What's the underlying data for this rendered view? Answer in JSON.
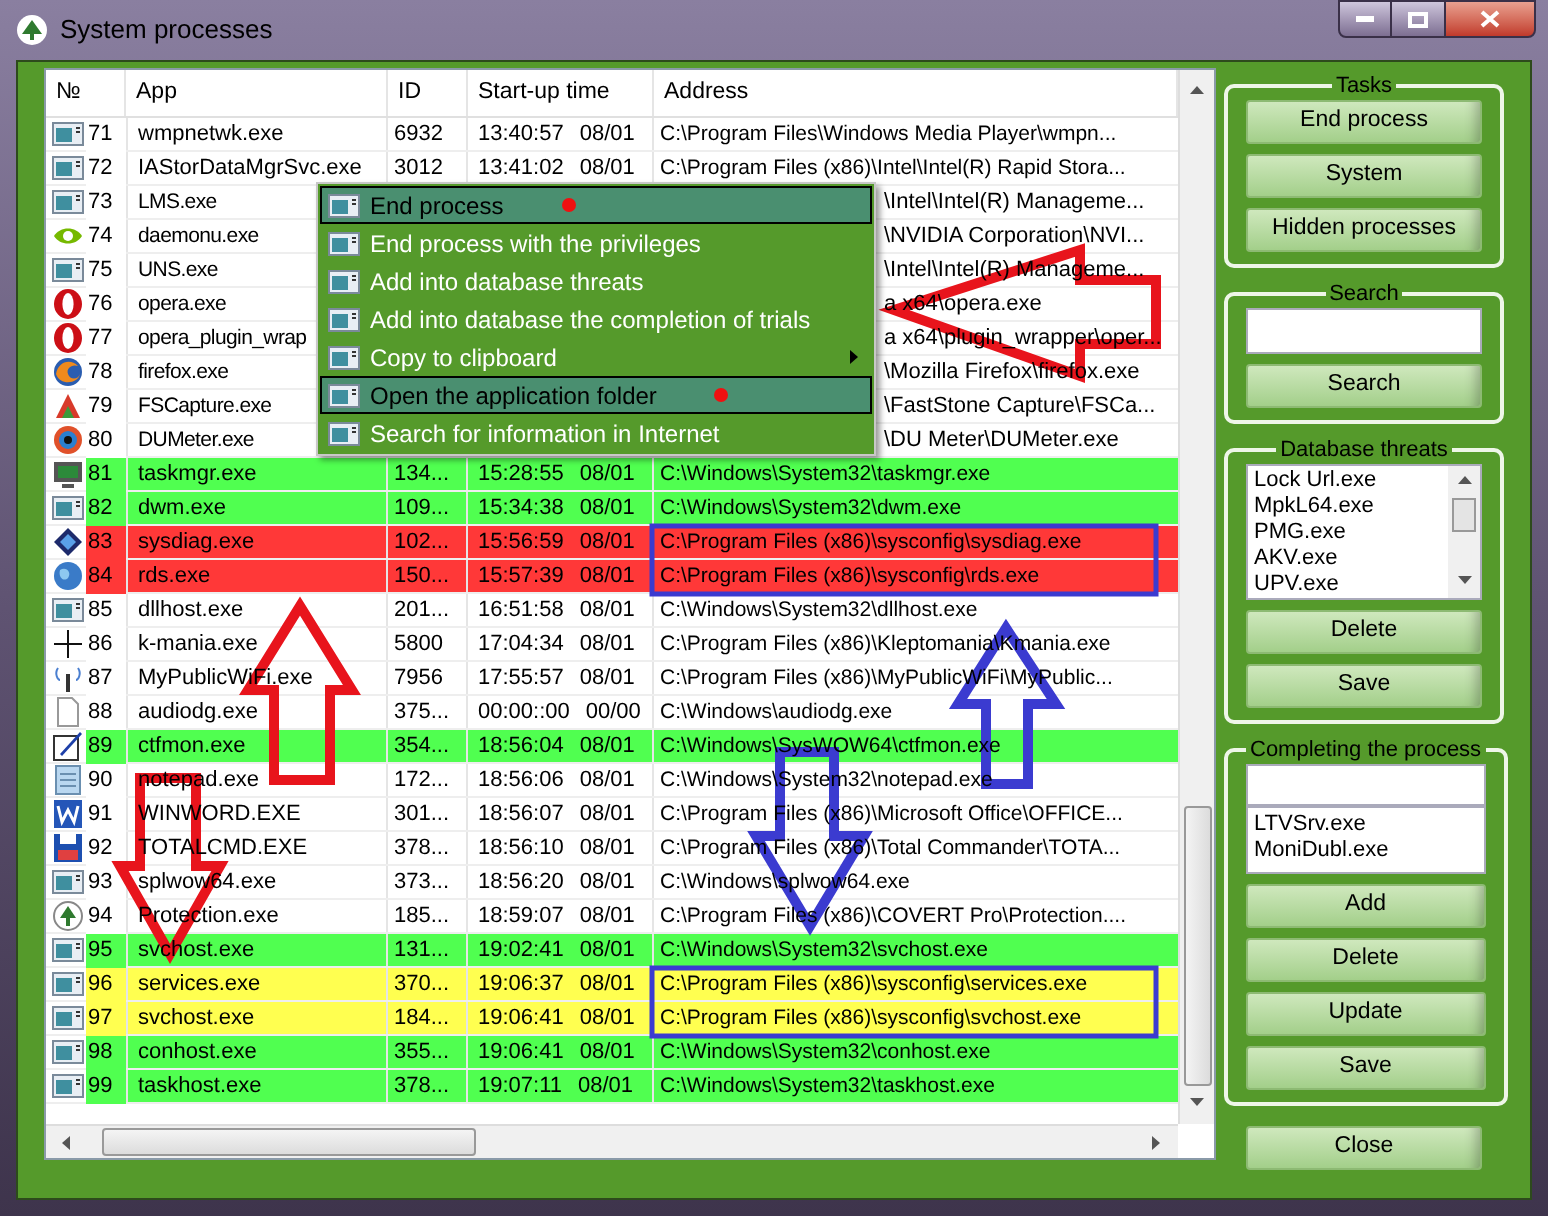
{
  "window": {
    "title": "System processes"
  },
  "table": {
    "columns": [
      "№",
      "App",
      "ID",
      "Start-up time",
      "Address"
    ],
    "rows": [
      {
        "no": "71",
        "app": "wmpnetwk.exe",
        "id": "6932",
        "time": "13:40:57",
        "date": "08/01",
        "address": "C:\\Program Files\\Windows Media Player\\wmpn...",
        "color": "#ffffff",
        "covered": false
      },
      {
        "no": "72",
        "app": "IAStorDataMgrSvc.exe",
        "id": "3012",
        "time": "13:41:02",
        "date": "08/01",
        "address": "C:\\Program Files (x86)\\Intel\\Intel(R) Rapid Stora...",
        "color": "#ffffff",
        "covered": false
      },
      {
        "no": "73",
        "app": "LMS.exe",
        "address": "\\Intel\\Intel(R) Manageme...",
        "color": "#ffffff",
        "covered": true
      },
      {
        "no": "74",
        "app": "daemonu.exe",
        "address": "\\NVIDIA Corporation\\NVI...",
        "color": "#ffffff",
        "covered": true
      },
      {
        "no": "75",
        "app": "UNS.exe",
        "address": "\\Intel\\Intel(R) Manageme...",
        "color": "#ffffff",
        "covered": true
      },
      {
        "no": "76",
        "app": "opera.exe",
        "address": "a x64\\opera.exe",
        "color": "#ffffff",
        "covered": true
      },
      {
        "no": "77",
        "app": "opera_plugin_wrap",
        "address": "a x64\\plugin_wrapper\\oper...",
        "color": "#ffffff",
        "covered": true
      },
      {
        "no": "78",
        "app": "firefox.exe",
        "address": "\\Mozilla Firefox\\firefox.exe",
        "color": "#ffffff",
        "covered": true
      },
      {
        "no": "79",
        "app": "FSCapture.exe",
        "address": "\\FastStone Capture\\FSCa...",
        "color": "#ffffff",
        "covered": true
      },
      {
        "no": "80",
        "app": "DUMeter.exe",
        "address": "\\DU Meter\\DUMeter.exe",
        "color": "#ffffff",
        "covered": true
      },
      {
        "no": "81",
        "app": "taskmgr.exe",
        "id": "134...",
        "time": "15:28:55",
        "date": "08/01",
        "address": "C:\\Windows\\System32\\taskmgr.exe",
        "color": "#50ff50",
        "covered": false
      },
      {
        "no": "82",
        "app": "dwm.exe",
        "id": "109...",
        "time": "15:34:38",
        "date": "08/01",
        "address": "C:\\Windows\\System32\\dwm.exe",
        "color": "#50ff50",
        "covered": false
      },
      {
        "no": "83",
        "app": "sysdiag.exe",
        "id": "102...",
        "time": "15:56:59",
        "date": "08/01",
        "address": "C:\\Program Files (x86)\\sysconfig\\sysdiag.exe",
        "color": "#ff3838",
        "covered": false
      },
      {
        "no": "84",
        "app": "rds.exe",
        "id": "150...",
        "time": "15:57:39",
        "date": "08/01",
        "address": "C:\\Program Files (x86)\\sysconfig\\rds.exe",
        "color": "#ff3838",
        "covered": false
      },
      {
        "no": "85",
        "app": "dllhost.exe",
        "id": "201...",
        "time": "16:51:58",
        "date": "08/01",
        "address": "C:\\Windows\\System32\\dllhost.exe",
        "color": "#ffffff",
        "covered": false
      },
      {
        "no": "86",
        "app": "k-mania.exe",
        "id": "5800",
        "time": "17:04:34",
        "date": "08/01",
        "address": "C:\\Program Files (x86)\\Kleptomania\\Kmania.exe",
        "color": "#ffffff",
        "covered": false
      },
      {
        "no": "87",
        "app": "MyPublicWiFi.exe",
        "id": "7956",
        "time": "17:55:57",
        "date": "08/01",
        "address": "C:\\Program Files (x86)\\MyPublicWiFi\\MyPublic...",
        "color": "#ffffff",
        "covered": false
      },
      {
        "no": "88",
        "app": "audiodg.exe",
        "id": "375...",
        "time": "00:00::00",
        "date": "00/00",
        "address": "C:\\Windows\\audiodg.exe",
        "color": "#ffffff",
        "covered": false
      },
      {
        "no": "89",
        "app": "ctfmon.exe",
        "id": "354...",
        "time": "18:56:04",
        "date": "08/01",
        "address": "C:\\Windows\\SysWOW64\\ctfmon.exe",
        "color": "#50ff50",
        "covered": false
      },
      {
        "no": "90",
        "app": "notepad.exe",
        "id": "172...",
        "time": "18:56:06",
        "date": "08/01",
        "address": "C:\\Windows\\System32\\notepad.exe",
        "color": "#ffffff",
        "covered": false
      },
      {
        "no": "91",
        "app": "WINWORD.EXE",
        "id": "301...",
        "time": "18:56:07",
        "date": "08/01",
        "address": "C:\\Program Files (x86)\\Microsoft Office\\OFFICE...",
        "color": "#ffffff",
        "covered": false
      },
      {
        "no": "92",
        "app": "TOTALCMD.EXE",
        "id": "378...",
        "time": "18:56:10",
        "date": "08/01",
        "address": "C:\\Program Files (x86)\\Total Commander\\TOTA...",
        "color": "#ffffff",
        "covered": false
      },
      {
        "no": "93",
        "app": "splwow64.exe",
        "id": "373...",
        "time": "18:56:20",
        "date": "08/01",
        "address": "C:\\Windows\\splwow64.exe",
        "color": "#ffffff",
        "covered": false
      },
      {
        "no": "94",
        "app": "Protection.exe",
        "id": "185...",
        "time": "18:59:07",
        "date": "08/01",
        "address": "C:\\Program Files (x86)\\COVERT Pro\\Protection....",
        "color": "#ffffff",
        "covered": false
      },
      {
        "no": "95",
        "app": "svchost.exe",
        "id": "131...",
        "time": "19:02:41",
        "date": "08/01",
        "address": "C:\\Windows\\System32\\svchost.exe",
        "color": "#50ff50",
        "covered": false
      },
      {
        "no": "96",
        "app": "services.exe",
        "id": "370...",
        "time": "19:06:37",
        "date": "08/01",
        "address": "C:\\Program Files (x86)\\sysconfig\\services.exe",
        "color": "#ffff50",
        "covered": false
      },
      {
        "no": "97",
        "app": "svchost.exe",
        "id": "184...",
        "time": "19:06:41",
        "date": "08/01",
        "address": "C:\\Program Files (x86)\\sysconfig\\svchost.exe",
        "color": "#ffff50",
        "covered": false
      },
      {
        "no": "98",
        "app": "conhost.exe",
        "id": "355...",
        "time": "19:06:41",
        "date": "08/01",
        "address": "C:\\Windows\\System32\\conhost.exe",
        "color": "#50ff50",
        "covered": false
      },
      {
        "no": "99",
        "app": "taskhost.exe",
        "id": "378...",
        "time": "19:07:11",
        "date": "08/01",
        "address": "C:\\Windows\\System32\\taskhost.exe",
        "color": "#50ff50",
        "covered": false
      }
    ]
  },
  "context_menu": {
    "items": [
      {
        "label": "End process",
        "highlighted": true,
        "submenu": false
      },
      {
        "label": "End process with the privileges",
        "highlighted": false,
        "submenu": false
      },
      {
        "label": "Add into database threats",
        "highlighted": false,
        "submenu": false
      },
      {
        "label": "Add into database the completion of trials",
        "highlighted": false,
        "submenu": false
      },
      {
        "label": "Copy to clipboard",
        "highlighted": false,
        "submenu": true
      },
      {
        "label": "Open the application folder",
        "highlighted": true,
        "submenu": false
      },
      {
        "label": "Search for information in Internet",
        "highlighted": false,
        "submenu": false
      }
    ]
  },
  "tasks": {
    "title": "Tasks",
    "buttons": [
      "End process",
      "System",
      "Hidden processes"
    ]
  },
  "search": {
    "title": "Search",
    "button": "Search"
  },
  "threats": {
    "title": "Database threats",
    "items": [
      "Lock Url.exe",
      "MpkL64.exe",
      "PMG.exe",
      "AKV.exe",
      "UPV.exe"
    ],
    "buttons": [
      "Delete",
      "Save"
    ]
  },
  "completing": {
    "title": "Completing the process",
    "items": [
      "LTVSrv.exe",
      "MoniDubl.exe"
    ],
    "buttons": [
      "Add",
      "Delete",
      "Update",
      "Save"
    ]
  },
  "close_button": "Close"
}
